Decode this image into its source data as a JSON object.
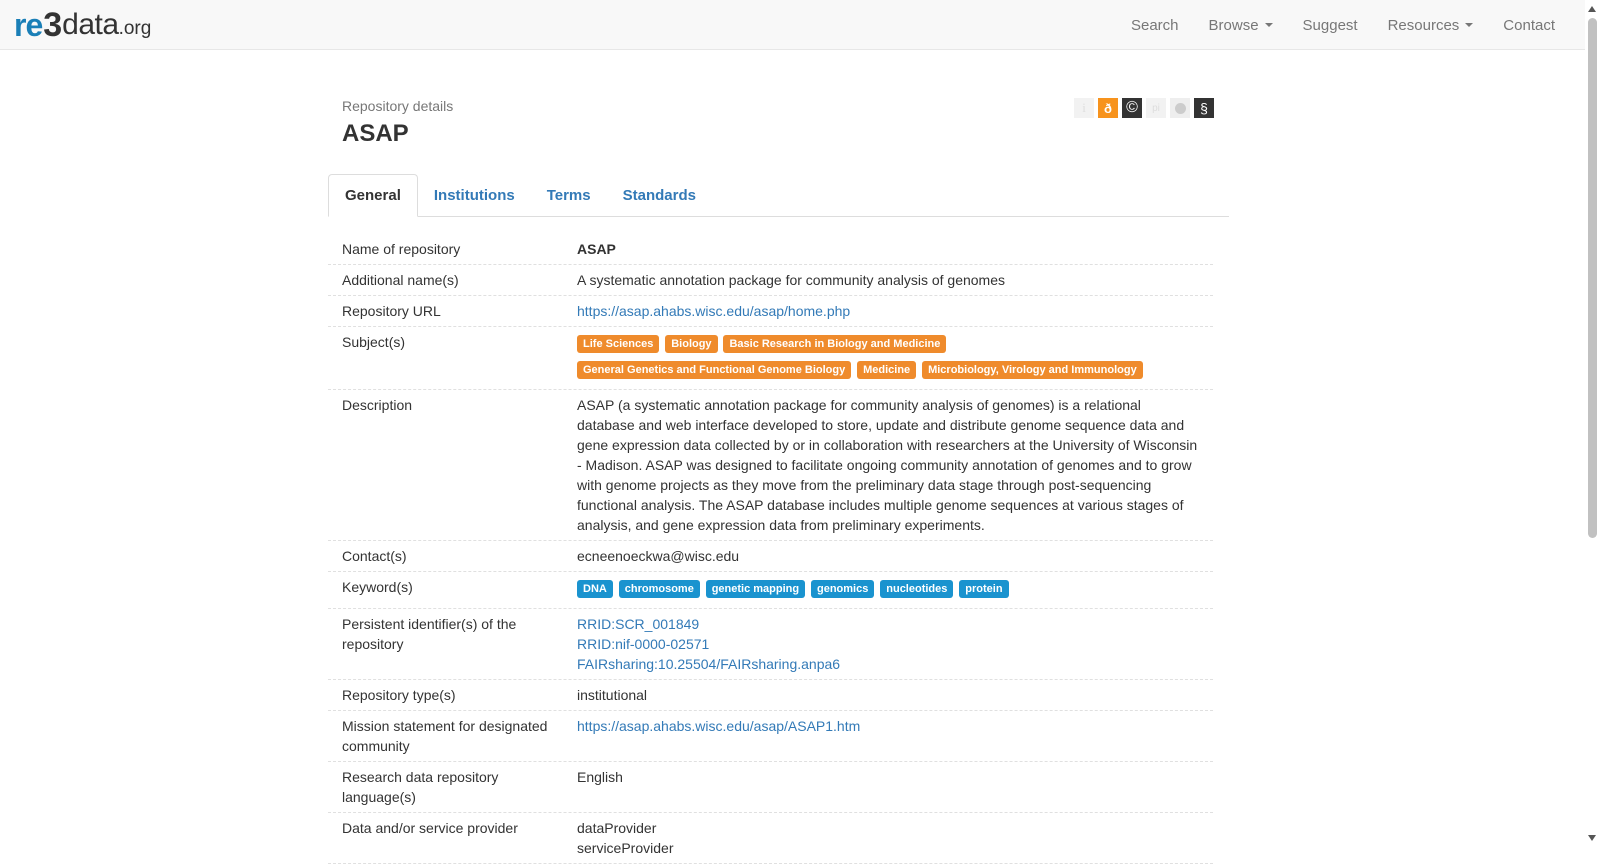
{
  "navbar": {
    "logo": {
      "re": "re",
      "three": "3",
      "data": "data",
      "org": ".org"
    },
    "items": [
      {
        "label": "Search",
        "dropdown": false
      },
      {
        "label": "Browse",
        "dropdown": true
      },
      {
        "label": "Suggest",
        "dropdown": false
      },
      {
        "label": "Resources",
        "dropdown": true
      },
      {
        "label": "Contact",
        "dropdown": false
      }
    ]
  },
  "header": {
    "subtitle": "Repository details",
    "title": "ASAP",
    "icons": {
      "info": "i",
      "open_access": "ð",
      "copyright": "©",
      "pid": "pi",
      "policy": "§"
    }
  },
  "tabs": [
    {
      "label": "General",
      "active": true
    },
    {
      "label": "Institutions",
      "active": false
    },
    {
      "label": "Terms",
      "active": false
    },
    {
      "label": "Standards",
      "active": false
    }
  ],
  "details": {
    "name": {
      "label": "Name of repository",
      "value": "ASAP"
    },
    "additional_names": {
      "label": "Additional name(s)",
      "value": "A systematic annotation package for community analysis of genomes"
    },
    "url": {
      "label": "Repository URL",
      "value": "https://asap.ahabs.wisc.edu/asap/home.php"
    },
    "subjects": {
      "label": "Subject(s)",
      "items": [
        "Life Sciences",
        "Biology",
        "Basic Research in Biology and Medicine",
        "General Genetics and Functional Genome Biology",
        "Medicine",
        "Microbiology, Virology and Immunology"
      ]
    },
    "description": {
      "label": "Description",
      "value": "ASAP (a systematic annotation package for community analysis of genomes) is a relational database and web interface developed to store, update and distribute genome sequence data and gene expression data collected by or in collaboration with researchers at the University of Wisconsin - Madison. ASAP was designed to facilitate ongoing community annotation of genomes and to grow with genome projects as they move from the preliminary data stage through post-sequencing functional analysis. The ASAP database includes multiple genome sequences at various stages of analysis, and gene expression data from preliminary experiments."
    },
    "contacts": {
      "label": "Contact(s)",
      "value": "ecneenoeckwa@wisc.edu"
    },
    "keywords": {
      "label": "Keyword(s)",
      "items": [
        "DNA",
        "chromosome",
        "genetic mapping",
        "genomics",
        "nucleotides",
        "protein"
      ]
    },
    "pids": {
      "label": "Persistent identifier(s) of the repository",
      "items": [
        "RRID:SCR_001849",
        "RRID:nif-0000-02571",
        "FAIRsharing:10.25504/FAIRsharing.anpa6"
      ]
    },
    "repo_type": {
      "label": "Repository type(s)",
      "value": "institutional"
    },
    "mission": {
      "label": "Mission statement for designated community",
      "value": "https://asap.ahabs.wisc.edu/asap/ASAP1.htm"
    },
    "language": {
      "label": "Research data repository language(s)",
      "value": "English"
    },
    "provider": {
      "label": "Data and/or service provider",
      "items": [
        "dataProvider",
        "serviceProvider"
      ]
    }
  },
  "colors": {
    "link": "#337ab7",
    "subject_badge": "#ef8b2c",
    "keyword_badge": "#1a93cf",
    "navbar_bg": "#f8f8f8"
  }
}
